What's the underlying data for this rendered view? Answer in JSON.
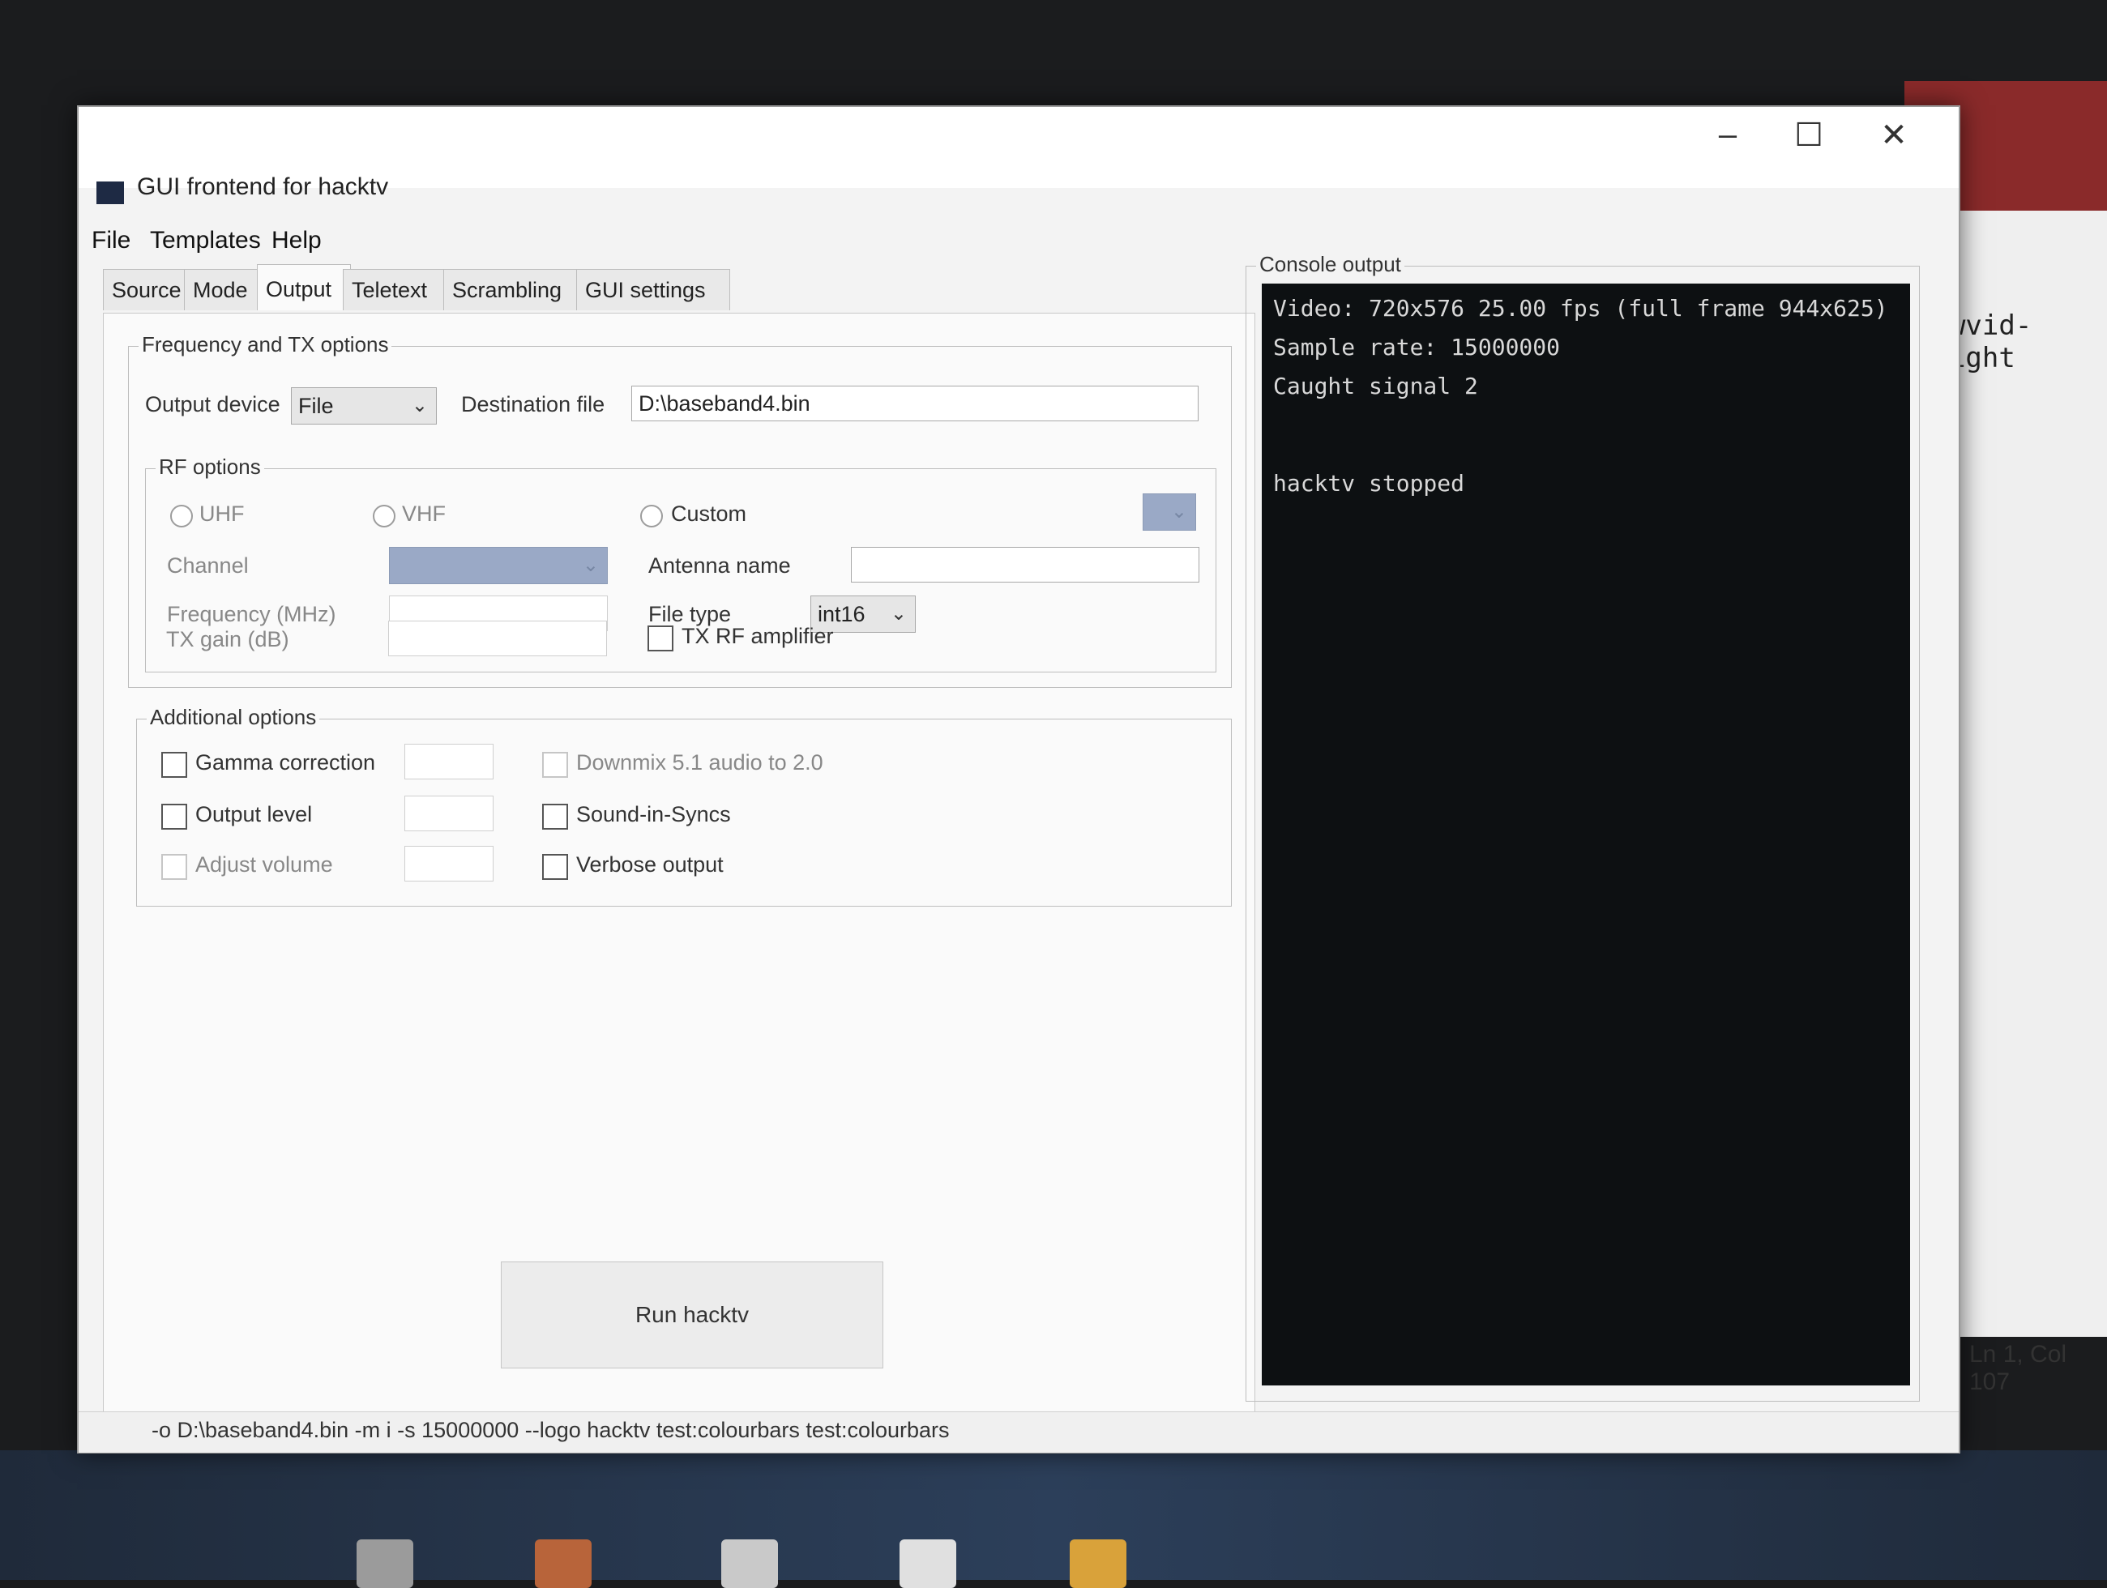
{
  "window": {
    "title": "GUI frontend for hacktv",
    "minimize": "–",
    "maximize": "☐",
    "close": "✕"
  },
  "menu": [
    "File",
    "Templates",
    "Help"
  ],
  "tabs": [
    "Source",
    "Mode",
    "Output",
    "Teletext",
    "Scrambling",
    "GUI settings"
  ],
  "active_tab": "Output",
  "freq_group": {
    "title": "Frequency and TX options",
    "output_device_label": "Output device",
    "output_device_value": "File",
    "destination_label": "Destination file",
    "destination_value": "D:\\baseband4.bin"
  },
  "rf_group": {
    "title": "RF options",
    "uhf": "UHF",
    "vhf": "VHF",
    "custom": "Custom",
    "channel_label": "Channel",
    "frequency_label": "Frequency (MHz)",
    "txgain_label": "TX gain (dB)",
    "antenna_label": "Antenna name",
    "filetype_label": "File type",
    "filetype_value": "int16",
    "tx_rf_amp": "TX RF amplifier"
  },
  "additional_group": {
    "title": "Additional options",
    "gamma": "Gamma correction",
    "output_level": "Output level",
    "adjust_volume": "Adjust volume",
    "downmix": "Downmix 5.1 audio to 2.0",
    "sound_in_syncs": "Sound-in-Syncs",
    "verbose": "Verbose output"
  },
  "run_button": "Run hacktv",
  "console": {
    "title": "Console output",
    "lines": [
      "Video: 720x576 25.00 fps (full frame 944x625)",
      "Sample rate: 15000000",
      "Caught signal 2",
      "",
      "hacktv stopped"
    ]
  },
  "status": "-o D:\\baseband4.bin -m i -s 15000000 --logo hacktv test:colourbars test:colourbars",
  "background": {
    "editor_text": "rawvid-height",
    "editor_status": "Ln 1, Col 107"
  }
}
